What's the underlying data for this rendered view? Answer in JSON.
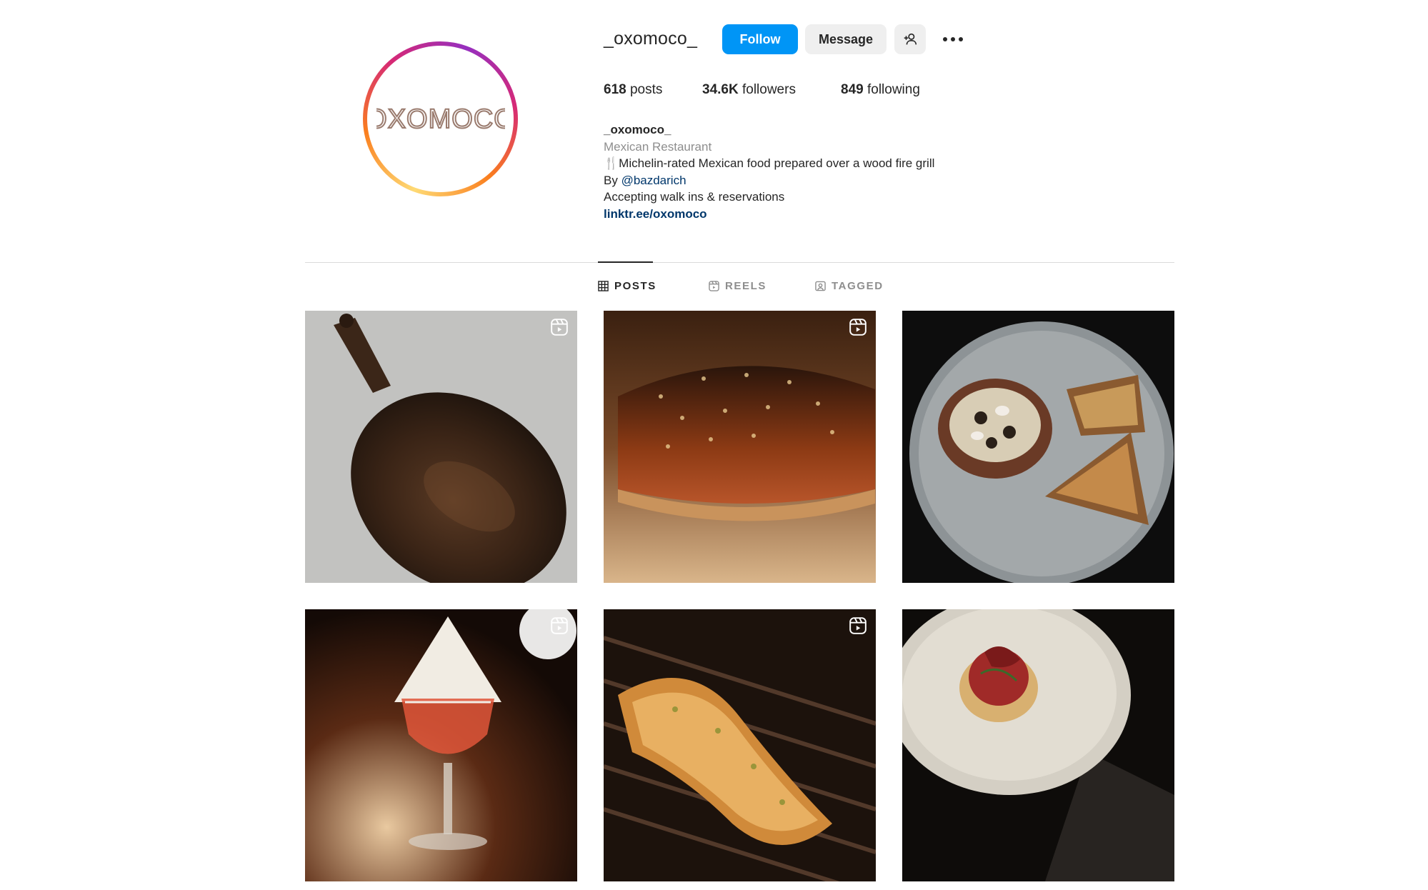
{
  "profile": {
    "username": "_oxomoco_",
    "avatar_logo": "OXOMOCO",
    "actions": {
      "follow_label": "Follow",
      "message_label": "Message",
      "suggest_icon": "add-person-icon",
      "more_icon": "more-horizontal-icon"
    },
    "stats": {
      "posts_count": "618",
      "posts_label": "posts",
      "followers_count": "34.6K",
      "followers_label": "followers",
      "following_count": "849",
      "following_label": "following"
    },
    "bio": {
      "name": "_oxomoco_",
      "category": "Mexican Restaurant",
      "line1": "🍴Michelin-rated Mexican food prepared over a wood fire grill",
      "line2_prefix": "By ",
      "line2_mention": "@bazdarich",
      "line3": "Accepting walk ins & reservations",
      "link": "linktr.ee/oxomoco"
    }
  },
  "tabs": [
    {
      "label": "POSTS",
      "icon": "grid-icon",
      "active": true
    },
    {
      "label": "REELS",
      "icon": "reels-icon",
      "active": false
    },
    {
      "label": "TAGGED",
      "icon": "tagged-icon",
      "active": false
    }
  ],
  "posts": [
    {
      "subject": "chicken",
      "reel": true
    },
    {
      "subject": "tostada",
      "reel": true
    },
    {
      "subject": "plate",
      "reel": false
    },
    {
      "subject": "cocktail",
      "reel": true
    },
    {
      "subject": "shrimp",
      "reel": true
    },
    {
      "subject": "tostada-plate",
      "reel": false
    }
  ],
  "colors": {
    "follow_blue": "#0095f6",
    "secondary_button": "#efefef",
    "link_blue": "#00376b",
    "muted_text": "#8e8e8e"
  }
}
